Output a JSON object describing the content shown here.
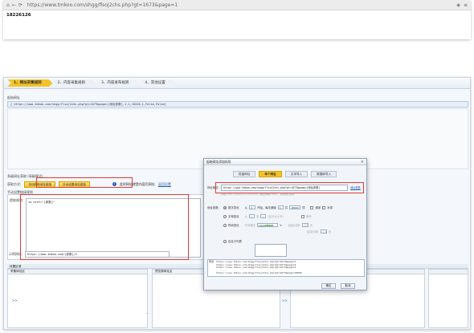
{
  "browser": {
    "url": "https://www.tmkoo.com/shgg/flsoj2chs.php?gt=1673&page=1",
    "page_number": "18226126"
  },
  "app": {
    "steps": [
      "1、网址采集规则",
      "2、内容采集规则",
      "3、内容发布规则",
      "4、其他设置"
    ],
    "start_url_label": "起始网址",
    "start_url_value": "[ https://www.tmkoo.com/shgg/flsoj2chs.php?gt=1673&page=[地址参数],1,1,18226,1,False,False]",
    "multi_level_label": "多级网址获取 (高级模式)",
    "method_label": "获取方式:",
    "btn_auto_get": "自动获取地址链接",
    "btn_manual": "手动设置地址链接",
    "info_text": "此时网址就是内容页网址",
    "info_link": "返回设置",
    "manual_section_label": "手动设置链接规则",
    "extract_label": "提取规则:",
    "extract_value": "<a href=\"[参数]\"",
    "example_label": "示例网址:",
    "example_value": "https://www.tmkoo.com/[参数]/2",
    "bottom_header": "设置区域",
    "panel1_head": "采集网址区",
    "panel2_head": "预览源网址区",
    "panel3_head": "已采集区"
  },
  "dialog": {
    "title": "起始网址添加向导",
    "tabs": [
      "批量网址",
      "单个网址",
      "文本导入",
      "数据库导入"
    ],
    "addr_label": "网址格式:",
    "addr_value": "https://www.tmkoo.com/shgg/flsoj2chs.php?gt=1673&page=[地址参数]",
    "addr_link": "地址参数",
    "hint": "(例如:http://www.xxx.com/xxxx_[地址参数].html，请用鼠标选择)",
    "param_label": "地址参数:",
    "opt_num": "数字变化",
    "num_from": "从",
    "num_from_val": "1",
    "num_step_label": "开始，每次递增",
    "num_step_val": "1",
    "num_count_label": "共",
    "num_count_val": "18000",
    "num_count_unit": "项",
    "chk_desc": "倒序",
    "chk_zero": "补零",
    "opt_letter": "字母变化",
    "letter_from": "从",
    "letter_from_val": "a",
    "letter_to": "到",
    "letter_to_val": "z",
    "letter_case": "(区分大小写)",
    "chk_desc2": "倒序",
    "opt_time": "时间变化",
    "time_label": "时间格式",
    "time_val": "yyyyMMdd",
    "time_start_label": "起始日期:",
    "time_start_val": "今天",
    "time_end_label": "结束日期:",
    "time_end_val": "今天",
    "time_offset": "天",
    "opt_custom": "自定义列表",
    "preview_label": "预览",
    "preview_lines": [
      "https://www.tmkoo.com/shgg/flsoj2chs.php?gt=1673&page=1",
      "https://www.tmkoo.com/shgg/flsoj2chs.php?gt=1673&page=2",
      "https://www.tmkoo.com/shgg/flsoj2chs.php?gt=1673&page=3",
      "........",
      "https://www.tmkoo.com/shgg/flsoj2chs.php?gt=1673&page=18000"
    ],
    "btn_ok": "确定",
    "btn_cancel": "取消"
  }
}
